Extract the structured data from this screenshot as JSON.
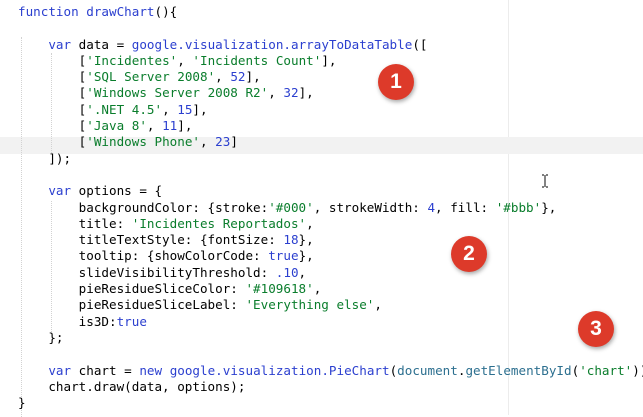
{
  "editor": {
    "lines": [
      [
        {
          "t": "function",
          "c": "kw"
        },
        {
          "t": " "
        },
        {
          "t": "drawChart",
          "c": "fn"
        },
        {
          "t": "(){"
        }
      ],
      [],
      [
        {
          "t": "    "
        },
        {
          "t": "var",
          "c": "kw"
        },
        {
          "t": " data = "
        },
        {
          "t": "google.visualization.arrayToDataTable",
          "c": "fn"
        },
        {
          "t": "(["
        }
      ],
      [
        {
          "t": "        ["
        },
        {
          "t": "'Incidentes'",
          "c": "str"
        },
        {
          "t": ", "
        },
        {
          "t": "'Incidents Count'",
          "c": "str"
        },
        {
          "t": "],"
        }
      ],
      [
        {
          "t": "        ["
        },
        {
          "t": "'SQL Server 2008'",
          "c": "str"
        },
        {
          "t": ", "
        },
        {
          "t": "52",
          "c": "num"
        },
        {
          "t": "],"
        }
      ],
      [
        {
          "t": "        ["
        },
        {
          "t": "'Windows Server 2008 R2'",
          "c": "str"
        },
        {
          "t": ", "
        },
        {
          "t": "32",
          "c": "num"
        },
        {
          "t": "],"
        }
      ],
      [
        {
          "t": "        ["
        },
        {
          "t": "'.NET 4.5'",
          "c": "str"
        },
        {
          "t": ", "
        },
        {
          "t": "15",
          "c": "num"
        },
        {
          "t": "],"
        }
      ],
      [
        {
          "t": "        ["
        },
        {
          "t": "'Java 8'",
          "c": "str"
        },
        {
          "t": ", "
        },
        {
          "t": "11",
          "c": "num"
        },
        {
          "t": "],"
        }
      ],
      [
        {
          "t": "        ["
        },
        {
          "t": "'Windows Phone'",
          "c": "str"
        },
        {
          "t": ", "
        },
        {
          "t": "23",
          "c": "num"
        },
        {
          "t": "]"
        }
      ],
      [
        {
          "t": "    ]);"
        }
      ],
      [],
      [
        {
          "t": "    "
        },
        {
          "t": "var",
          "c": "kw"
        },
        {
          "t": " options = {"
        }
      ],
      [
        {
          "t": "        backgroundColor: {stroke:"
        },
        {
          "t": "'#000'",
          "c": "str"
        },
        {
          "t": ", strokeWidth: "
        },
        {
          "t": "4",
          "c": "num"
        },
        {
          "t": ", fill: "
        },
        {
          "t": "'#bbb'",
          "c": "str"
        },
        {
          "t": "},"
        }
      ],
      [
        {
          "t": "        title: "
        },
        {
          "t": "'Incidentes Reportados'",
          "c": "str"
        },
        {
          "t": ","
        }
      ],
      [
        {
          "t": "        titleTextStyle: {fontSize: "
        },
        {
          "t": "18",
          "c": "num"
        },
        {
          "t": "},"
        }
      ],
      [
        {
          "t": "        tooltip: {showColorCode: "
        },
        {
          "t": "true",
          "c": "bool"
        },
        {
          "t": "},"
        }
      ],
      [
        {
          "t": "        slideVisibilityThreshold: "
        },
        {
          "t": ".10",
          "c": "num"
        },
        {
          "t": ","
        }
      ],
      [
        {
          "t": "        pieResidueSliceColor: "
        },
        {
          "t": "'#109618'",
          "c": "str"
        },
        {
          "t": ","
        }
      ],
      [
        {
          "t": "        pieResidueSliceLabel: "
        },
        {
          "t": "'Everything else'",
          "c": "str"
        },
        {
          "t": ","
        }
      ],
      [
        {
          "t": "        is3D:"
        },
        {
          "t": "true",
          "c": "bool"
        }
      ],
      [
        {
          "t": "    };"
        }
      ],
      [],
      [
        {
          "t": "    "
        },
        {
          "t": "var",
          "c": "kw"
        },
        {
          "t": " chart = "
        },
        {
          "t": "new",
          "c": "kw"
        },
        {
          "t": " "
        },
        {
          "t": "google.visualization.PieChart",
          "c": "fn"
        },
        {
          "t": "("
        },
        {
          "t": "document",
          "c": "obj"
        },
        {
          "t": "."
        },
        {
          "t": "getElementById",
          "c": "obj"
        },
        {
          "t": "("
        },
        {
          "t": "'chart'",
          "c": "str"
        },
        {
          "t": "));"
        }
      ],
      [
        {
          "t": "    chart.draw(data, options);"
        }
      ],
      [
        {
          "t": "}"
        }
      ]
    ]
  },
  "badges": {
    "one": "1",
    "two": "2",
    "three": "3"
  },
  "colors": {
    "badge": "#dd3a2a",
    "keyword": "#2b3fcf",
    "string": "#0a7d2c"
  }
}
